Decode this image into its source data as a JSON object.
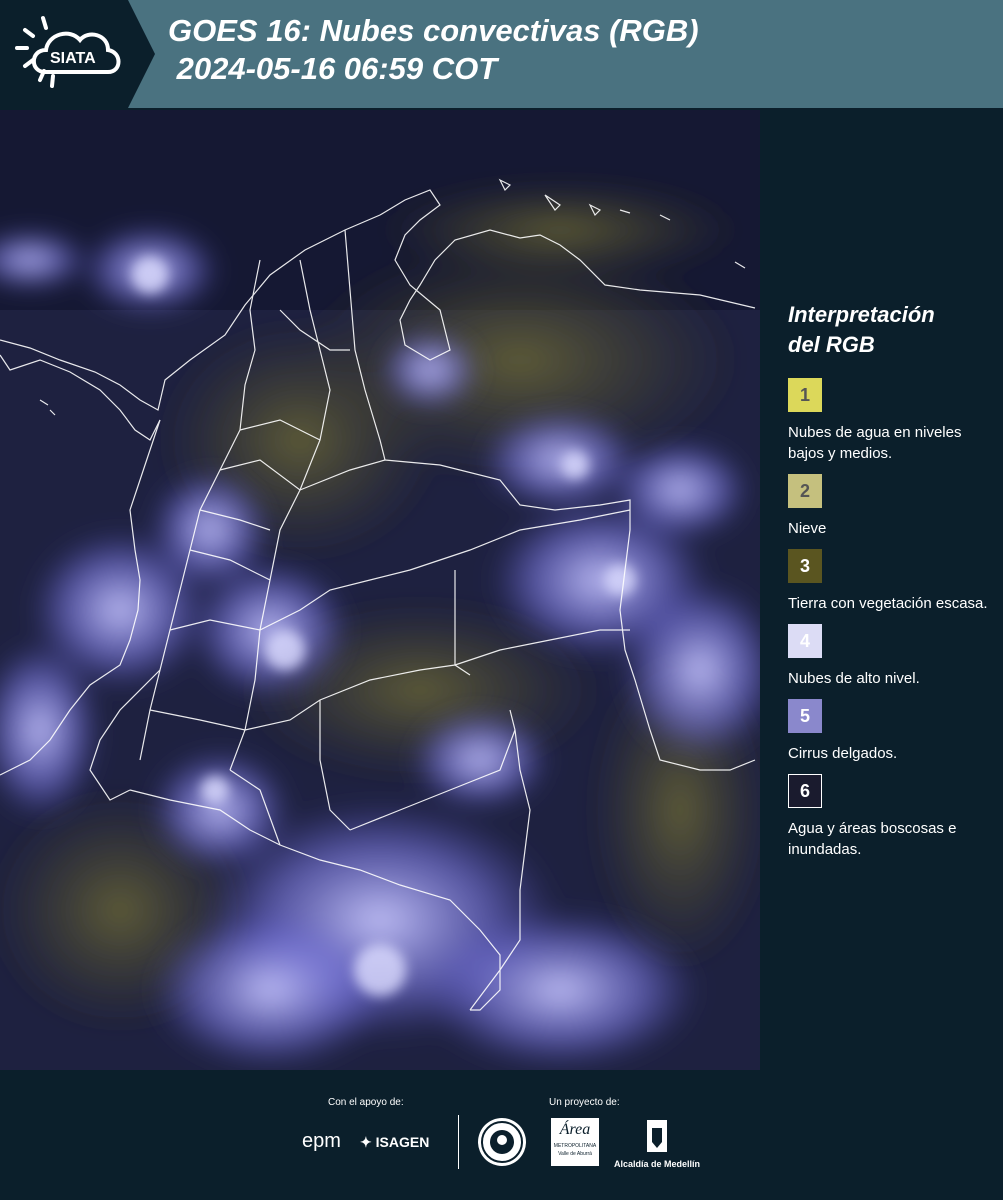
{
  "header": {
    "logo_text": "SIATA",
    "title_line1": "GOES 16: Nubes convectivas (RGB)",
    "title_line2": " 2024-05-16 06:59 COT"
  },
  "legend": {
    "title_line1": "Interpretación",
    "title_line2": "del RGB",
    "items": [
      {
        "number": "1",
        "label": "Nubes de agua en niveles bajos y medios.",
        "color": "#dcd85a"
      },
      {
        "number": "2",
        "label": "Nieve",
        "color": "#c5c07e"
      },
      {
        "number": "3",
        "label": "Tierra con vegetación escasa.",
        "color": "#5a5520"
      },
      {
        "number": "4",
        "label": "Nubes de alto nivel.",
        "color": "#dcdcf5"
      },
      {
        "number": "5",
        "label": "Cirrus delgados.",
        "color": "#8a88cc"
      },
      {
        "number": "6",
        "label": "Agua y áreas boscosas e inundadas.",
        "color": "#1a1b2e"
      }
    ]
  },
  "footer": {
    "support_label": "Con el apoyo de:",
    "project_label": "Un proyecto de:",
    "sponsor_epm": "epm",
    "sponsor_isagen": "ISAGEN",
    "area_word": "Área",
    "area_sub1": "METROPOLITANA",
    "area_sub2": "Valle de Aburrá",
    "alcaldia": "Alcaldía de Medellín"
  },
  "colors": {
    "header_bg": "#4a7280",
    "page_bg": "#0b1f2b",
    "border_line": "#ffffff"
  }
}
